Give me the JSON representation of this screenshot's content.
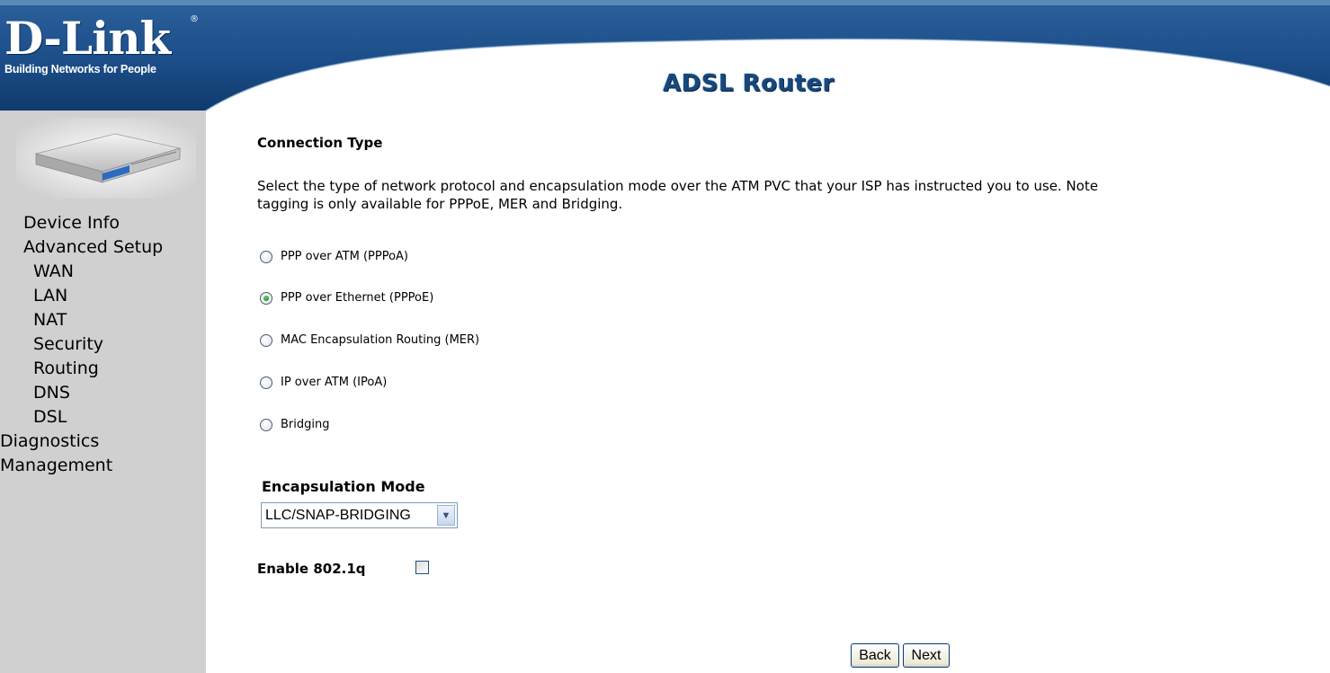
{
  "header": {
    "logo_text": "D-Link",
    "logo_registered": "®",
    "logo_tagline": "Building Networks for People",
    "product_title": "ADSL Router"
  },
  "sidebar": {
    "items": [
      {
        "label": "Device Info",
        "level": 1
      },
      {
        "label": "Advanced Setup",
        "level": 1
      },
      {
        "label": "WAN",
        "level": 2
      },
      {
        "label": "LAN",
        "level": 2
      },
      {
        "label": "NAT",
        "level": 2
      },
      {
        "label": "Security",
        "level": 2
      },
      {
        "label": "Routing",
        "level": 2
      },
      {
        "label": "DNS",
        "level": 2
      },
      {
        "label": "DSL",
        "level": 2
      },
      {
        "label": "Diagnostics",
        "level": 1
      },
      {
        "label": "Management",
        "level": 1
      }
    ]
  },
  "main": {
    "section_title": "Connection Type",
    "description_line1": "Select the type of network protocol and encapsulation mode over the ATM PVC that your ISP has instructed you to use. Note",
    "description_line2": "tagging is only available for PPPoE, MER and Bridging.",
    "protocols": [
      {
        "label": "PPP over ATM (PPPoA)",
        "selected": false
      },
      {
        "label": "PPP over Ethernet (PPPoE)",
        "selected": true
      },
      {
        "label": "MAC Encapsulation Routing (MER)",
        "selected": false
      },
      {
        "label": "IP over ATM (IPoA)",
        "selected": false
      },
      {
        "label": "Bridging",
        "selected": false
      }
    ],
    "encapsulation_label": "Encapsulation Mode",
    "encapsulation_value": "LLC/SNAP-BRIDGING",
    "enable_8021q_label": "Enable 802.1q",
    "enable_8021q_checked": false,
    "back_label": "Back",
    "next_label": "Next"
  },
  "colors": {
    "header_blue": "#1d4e88",
    "sidebar_gray": "#d0d0d0",
    "title_blue": "#16487c"
  }
}
